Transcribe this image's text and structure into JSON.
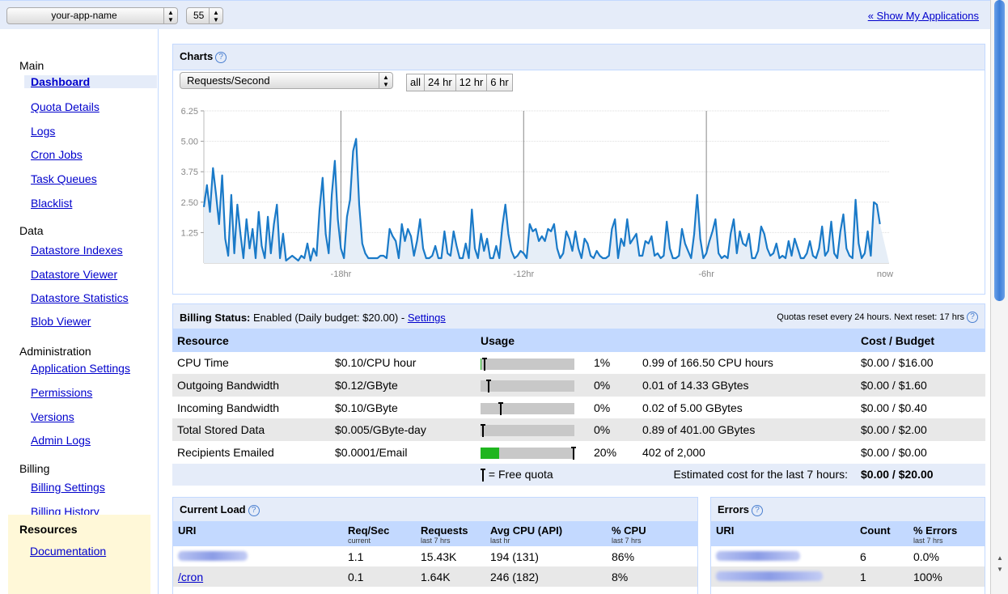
{
  "topbar": {
    "app_select": "your-app-name",
    "version_select": "55",
    "show_apps": "« Show My Applications"
  },
  "sidebar": {
    "sections": [
      {
        "title": "Main",
        "items": [
          "Dashboard",
          "Quota Details",
          "Logs",
          "Cron Jobs",
          "Task Queues",
          "Blacklist"
        ]
      },
      {
        "title": "Data",
        "items": [
          "Datastore Indexes",
          "Datastore Viewer",
          "Datastore Statistics",
          "Blob Viewer"
        ]
      },
      {
        "title": "Administration",
        "items": [
          "Application Settings",
          "Permissions",
          "Versions",
          "Admin Logs"
        ]
      },
      {
        "title": "Billing",
        "items": [
          "Billing Settings",
          "Billing History"
        ]
      }
    ],
    "resources_title": "Resources",
    "resources_link": "Documentation"
  },
  "charts": {
    "title": "Charts",
    "metric": "Requests/Second",
    "ranges": [
      "all",
      "24 hr",
      "12 hr",
      "6 hr"
    ]
  },
  "chart_data": {
    "type": "area",
    "title": "",
    "xlabel": "",
    "ylabel": "",
    "ylim": [
      0,
      6.25
    ],
    "yticks": [
      "6.25",
      "5.00",
      "3.75",
      "2.50",
      "1.25"
    ],
    "xticks": [
      "-18hr",
      "-12hr",
      "-6hr",
      "now"
    ],
    "xlim": [
      -22.5,
      0
    ],
    "grid": true,
    "x": [
      -22.5,
      -22.4,
      -22.3,
      -22.2,
      -22.1,
      -22.0,
      -21.9,
      -21.8,
      -21.7,
      -21.6,
      -21.5,
      -21.4,
      -21.3,
      -21.2,
      -21.1,
      -21.0,
      -20.9,
      -20.8,
      -20.7,
      -20.6,
      -20.5,
      -20.4,
      -20.3,
      -20.2,
      -20.1,
      -20.0,
      -19.9,
      -19.8,
      -19.7,
      -19.6,
      -19.5,
      -19.4,
      -19.3,
      -19.2,
      -19.1,
      -19.0,
      -18.9,
      -18.8,
      -18.7,
      -18.6,
      -18.5,
      -18.4,
      -18.3,
      -18.2,
      -18.1,
      -18.0,
      -17.9,
      -17.8,
      -17.7,
      -17.6,
      -17.5,
      -17.4,
      -17.3,
      -17.2,
      -17.1,
      -17.0,
      -16.9,
      -16.8,
      -16.7,
      -16.6,
      -16.5,
      -16.4,
      -16.3,
      -16.2,
      -16.1,
      -16.0,
      -15.9,
      -15.8,
      -15.7,
      -15.6,
      -15.5,
      -15.4,
      -15.3,
      -15.2,
      -15.1,
      -15.0,
      -14.9,
      -14.8,
      -14.7,
      -14.6,
      -14.5,
      -14.4,
      -14.3,
      -14.2,
      -14.1,
      -14.0,
      -13.9,
      -13.8,
      -13.7,
      -13.6,
      -13.5,
      -13.4,
      -13.3,
      -13.2,
      -13.1,
      -13.0,
      -12.9,
      -12.8,
      -12.7,
      -12.6,
      -12.5,
      -12.4,
      -12.3,
      -12.2,
      -12.1,
      -12.0,
      -11.9,
      -11.8,
      -11.7,
      -11.6,
      -11.5,
      -11.4,
      -11.3,
      -11.2,
      -11.1,
      -11.0,
      -10.9,
      -10.8,
      -10.7,
      -10.6,
      -10.5,
      -10.4,
      -10.3,
      -10.2,
      -10.1,
      -10.0,
      -9.9,
      -9.8,
      -9.7,
      -9.6,
      -9.5,
      -9.4,
      -9.3,
      -9.2,
      -9.1,
      -9.0,
      -8.9,
      -8.8,
      -8.7,
      -8.6,
      -8.5,
      -8.4,
      -8.3,
      -8.2,
      -8.1,
      -8.0,
      -7.9,
      -7.8,
      -7.7,
      -7.6,
      -7.5,
      -7.4,
      -7.3,
      -7.2,
      -7.1,
      -7.0,
      -6.9,
      -6.8,
      -6.7,
      -6.6,
      -6.5,
      -6.4,
      -6.3,
      -6.2,
      -6.1,
      -6.0,
      -5.9,
      -5.8,
      -5.7,
      -5.6,
      -5.5,
      -5.4,
      -5.3,
      -5.2,
      -5.1,
      -5.0,
      -4.9,
      -4.8,
      -4.7,
      -4.6,
      -4.5,
      -4.4,
      -4.3,
      -4.2,
      -4.1,
      -4.0,
      -3.9,
      -3.8,
      -3.7,
      -3.6,
      -3.5,
      -3.4,
      -3.3,
      -3.2,
      -3.1,
      -3.0,
      -2.9,
      -2.8,
      -2.7,
      -2.6,
      -2.5,
      -2.4,
      -2.3,
      -2.2,
      -2.1,
      -2.0,
      -1.9,
      -1.8,
      -1.7,
      -1.6,
      -1.5,
      -1.4,
      -1.3,
      -1.2,
      -1.1,
      -1.0,
      -0.9,
      -0.8,
      -0.7,
      -0.6,
      -0.5,
      -0.4,
      -0.3,
      -0.2,
      -0.1,
      0.0
    ],
    "series": [
      {
        "values": [
          2.3,
          3.2,
          2.1,
          3.9,
          2.8,
          1.6,
          3.6,
          1.0,
          0.3,
          2.8,
          0.4,
          2.4,
          1.2,
          0.2,
          1.8,
          0.6,
          1.4,
          0.2,
          2.1,
          0.7,
          0.2,
          1.9,
          0.4,
          1.6,
          2.4,
          0.2,
          1.2,
          0.1,
          0.2,
          0.3,
          0.2,
          0.1,
          0.3,
          0.2,
          0.8,
          0.1,
          0.6,
          0.3,
          2.2,
          3.5,
          1.2,
          0.4,
          2.8,
          4.2,
          1.8,
          0.6,
          0.2,
          1.9,
          2.6,
          4.6,
          5.1,
          2.4,
          0.8,
          0.4,
          0.2,
          0.2,
          0.2,
          0.2,
          0.3,
          0.3,
          0.2,
          1.4,
          1.1,
          0.9,
          0.2,
          1.6,
          0.9,
          1.4,
          1.1,
          0.3,
          0.9,
          1.8,
          0.6,
          0.2,
          0.2,
          0.3,
          0.7,
          0.2,
          0.2,
          1.3,
          0.4,
          0.3,
          1.3,
          0.7,
          0.2,
          0.2,
          0.8,
          0.2,
          2.2,
          0.6,
          0.2,
          1.2,
          0.5,
          1.0,
          0.2,
          0.2,
          0.7,
          0.2,
          1.5,
          2.4,
          1.2,
          0.5,
          0.2,
          0.3,
          0.5,
          0.4,
          0.2,
          1.6,
          1.3,
          1.4,
          0.9,
          1.1,
          0.9,
          1.4,
          1.3,
          1.6,
          0.6,
          0.2,
          0.4,
          1.3,
          1.0,
          0.5,
          1.3,
          0.6,
          0.2,
          1.0,
          0.8,
          0.3,
          0.2,
          0.5,
          0.3,
          0.2,
          0.2,
          0.3,
          1.4,
          1.8,
          0.2,
          1.0,
          0.7,
          1.8,
          0.8,
          1.0,
          1.2,
          0.3,
          0.3,
          0.9,
          0.8,
          1.1,
          0.3,
          0.4,
          0.2,
          0.3,
          1.7,
          0.6,
          0.2,
          0.2,
          0.3,
          1.4,
          0.8,
          0.5,
          0.2,
          1.2,
          2.8,
          1.0,
          0.2,
          0.4,
          0.9,
          1.3,
          1.8,
          0.4,
          0.2,
          0.3,
          0.2,
          1.2,
          1.8,
          0.4,
          1.3,
          0.8,
          0.7,
          1.2,
          0.2,
          0.2,
          0.5,
          1.5,
          1.2,
          0.6,
          0.3,
          0.4,
          0.8,
          0.2,
          0.3,
          0.2,
          0.9,
          0.3,
          1.0,
          0.6,
          0.2,
          0.2,
          0.4,
          0.9,
          0.3,
          0.2,
          0.6,
          1.5,
          0.3,
          0.5,
          1.7,
          0.4,
          0.2,
          1.3,
          2.0,
          0.6,
          0.3,
          0.2,
          2.6,
          0.8,
          0.2,
          0.4,
          1.3,
          0.3,
          2.5,
          2.4,
          1.6
        ]
      }
    ]
  },
  "billing": {
    "title_prefix": "Billing Status:",
    "title_text": "Enabled (Daily budget: $20.00) -",
    "settings_link": "Settings",
    "reset_text": "Quotas reset every 24 hours. Next reset: 17 hrs",
    "headers": {
      "resource": "Resource",
      "usage": "Usage",
      "cost": "Cost / Budget"
    },
    "rows": [
      {
        "resource": "CPU Time",
        "rate": "$0.10/CPU hour",
        "pct": "1%",
        "fill": 0.01,
        "quota_mark": 0.02,
        "amount": "0.99 of 166.50 CPU hours",
        "cost": "$0.00 / $16.00"
      },
      {
        "resource": "Outgoing Bandwidth",
        "rate": "$0.12/GByte",
        "pct": "0%",
        "fill": 0.0,
        "quota_mark": 0.06,
        "amount": "0.01 of 14.33 GBytes",
        "cost": "$0.00 / $1.60"
      },
      {
        "resource": "Incoming Bandwidth",
        "rate": "$0.10/GByte",
        "pct": "0%",
        "fill": 0.0,
        "quota_mark": 0.2,
        "amount": "0.02 of 5.00 GBytes",
        "cost": "$0.00 / $0.40"
      },
      {
        "resource": "Total Stored Data",
        "rate": "$0.005/GByte-day",
        "pct": "0%",
        "fill": 0.0,
        "quota_mark": 0.0,
        "amount": "0.89 of 401.00 GBytes",
        "cost": "$0.00 / $2.00"
      },
      {
        "resource": "Recipients Emailed",
        "rate": "$0.0001/Email",
        "pct": "20%",
        "fill": 0.2,
        "quota_mark": 1.0,
        "amount": "402 of 2,000",
        "cost": "$0.00 / $0.00"
      }
    ],
    "legend": "= Free quota",
    "estimate_label": "Estimated cost for the last 7 hours:",
    "estimate_value": "$0.00 / $20.00"
  },
  "current_load": {
    "title": "Current Load",
    "headers": [
      {
        "label": "URI",
        "sub": ""
      },
      {
        "label": "Req/Sec",
        "sub": "current"
      },
      {
        "label": "Requests",
        "sub": "last 7 hrs"
      },
      {
        "label": "Avg CPU (API)",
        "sub": "last hr"
      },
      {
        "label": "% CPU",
        "sub": "last 7 hrs"
      }
    ],
    "rows": [
      {
        "uri": "",
        "req_sec": "1.1",
        "requests": "15.43K",
        "avg_cpu": "194 (131)",
        "pct_cpu": "86%"
      },
      {
        "uri": "/cron",
        "req_sec": "0.1",
        "requests": "1.64K",
        "avg_cpu": "246 (182)",
        "pct_cpu": "8%"
      }
    ]
  },
  "errors": {
    "title": "Errors",
    "headers": [
      {
        "label": "URI",
        "sub": ""
      },
      {
        "label": "Count",
        "sub": ""
      },
      {
        "label": "% Errors",
        "sub": "last 7 hrs"
      }
    ],
    "rows": [
      {
        "uri": "",
        "count": "6",
        "pct": "0.0%"
      },
      {
        "uri": "",
        "count": "1",
        "pct": "100%"
      }
    ]
  }
}
